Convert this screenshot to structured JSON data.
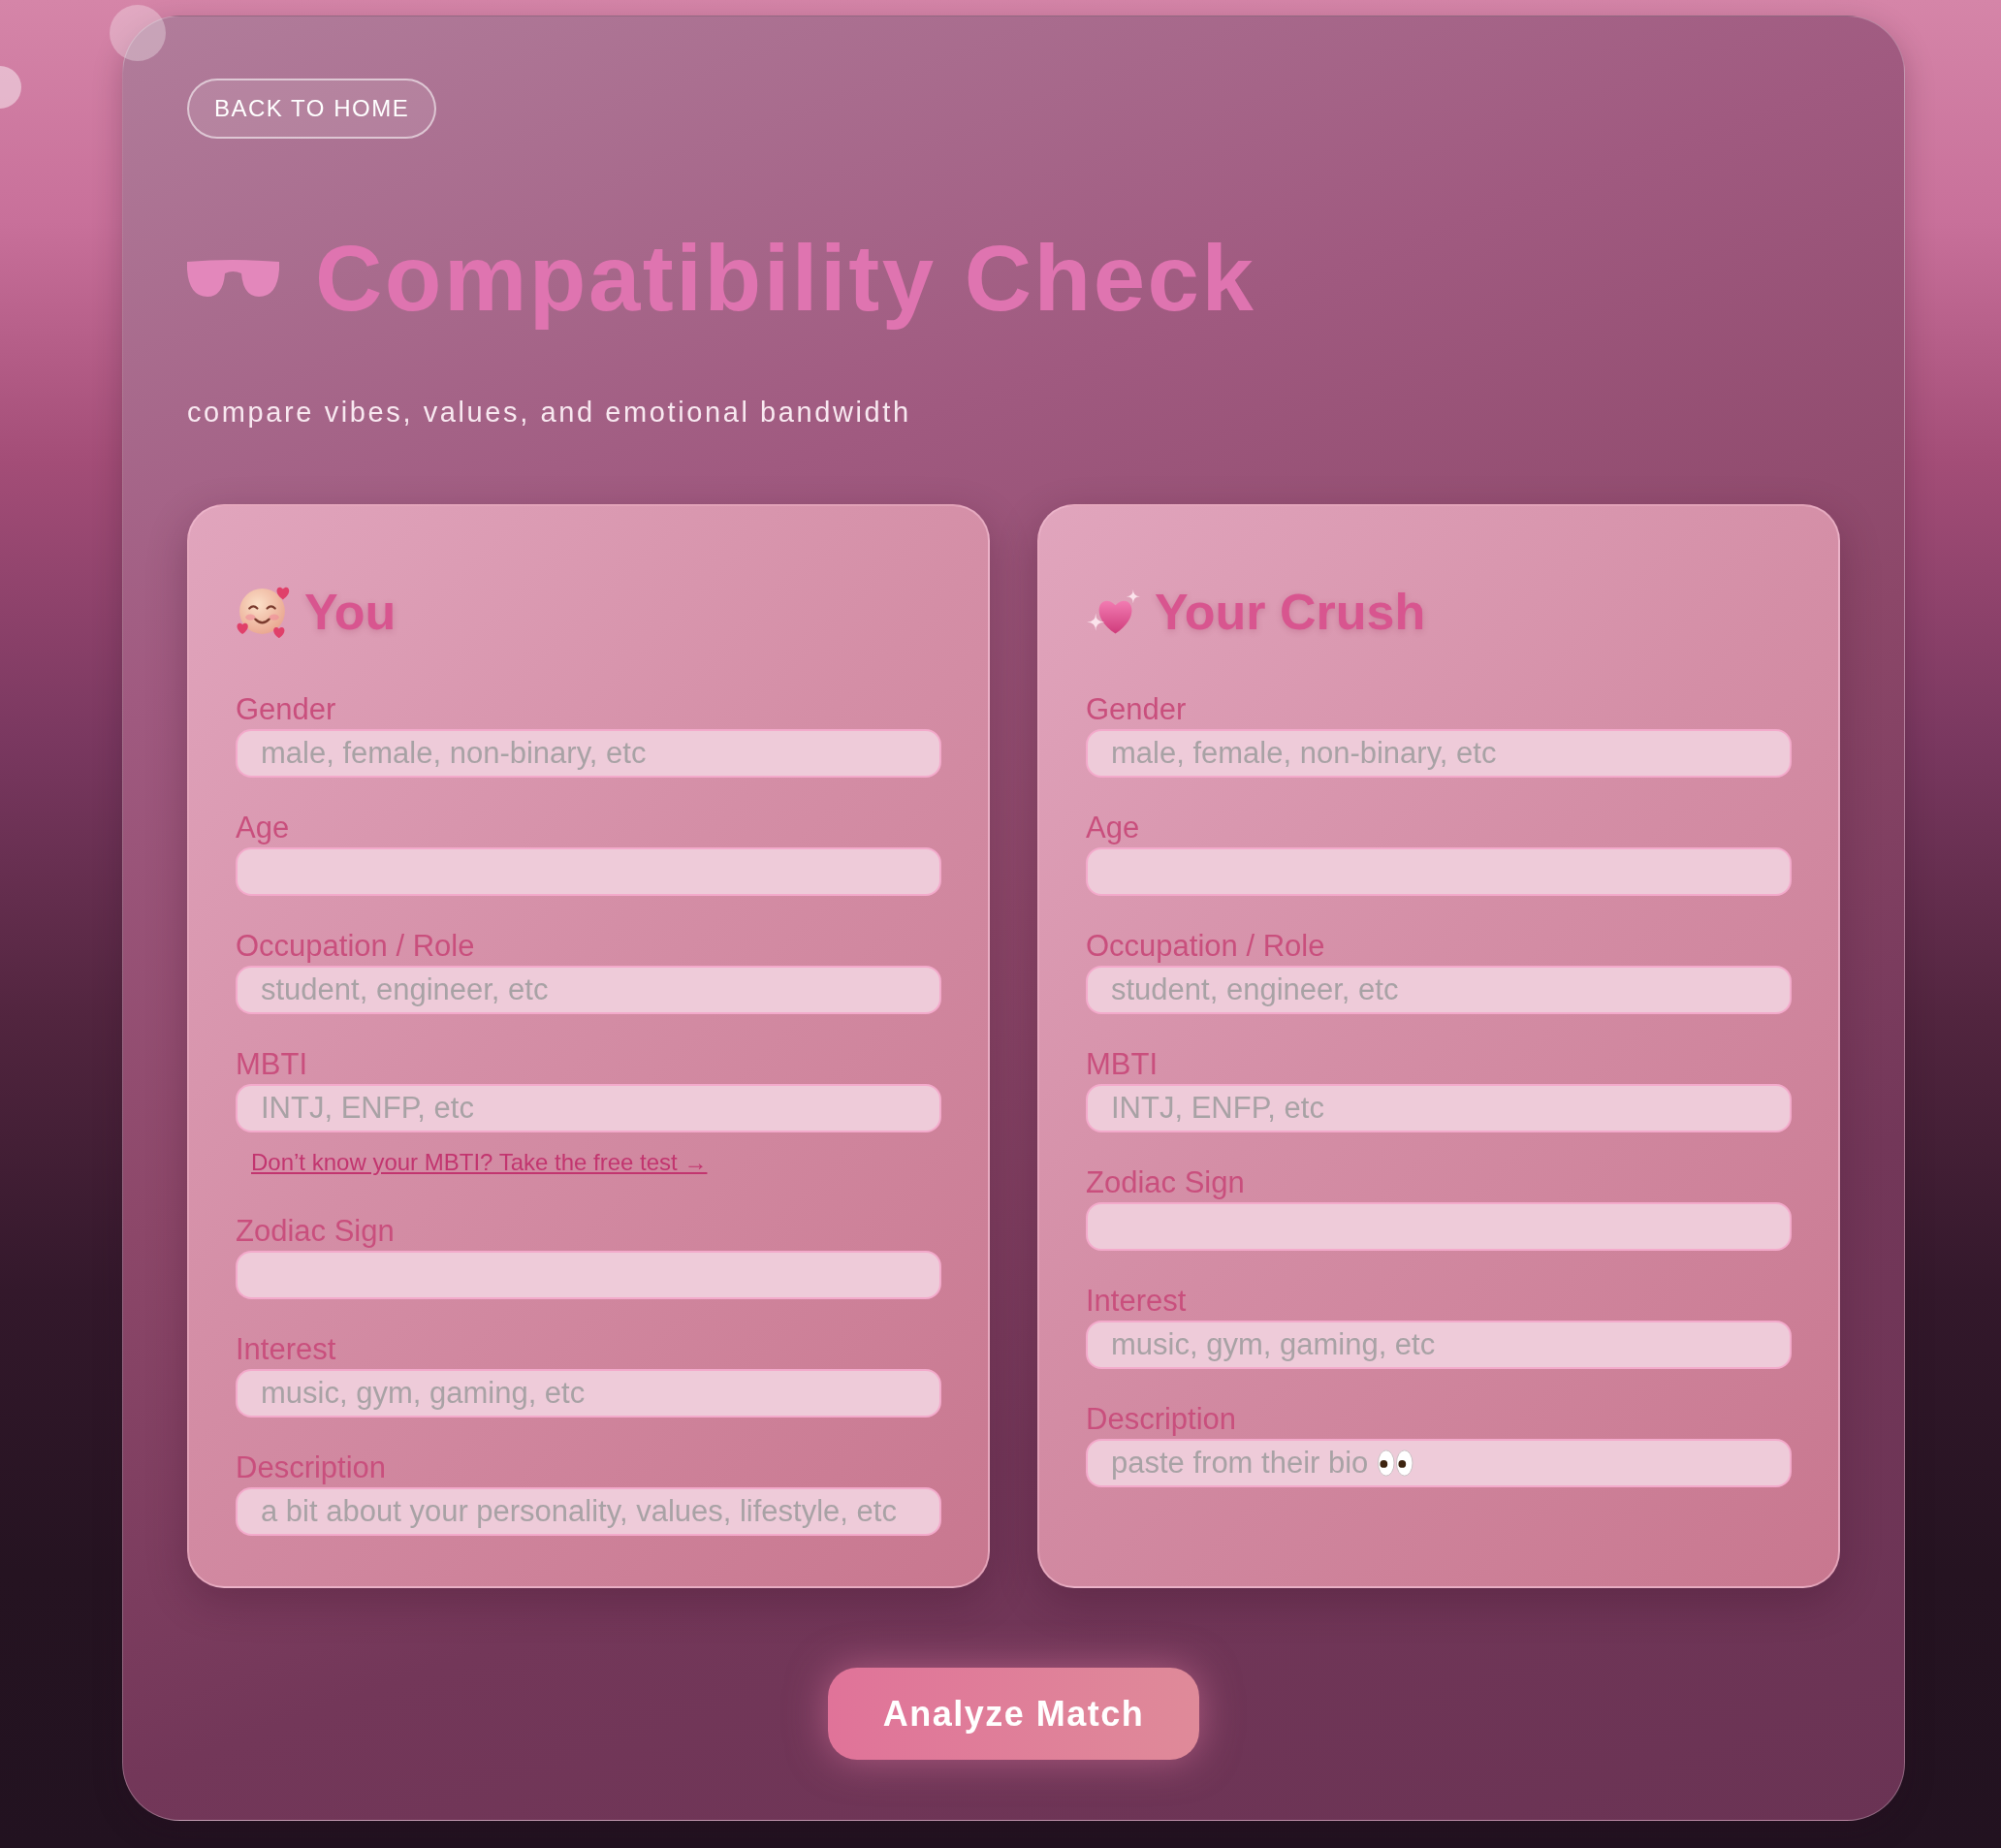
{
  "back_button": {
    "label": "BACK TO HOME"
  },
  "title": "Compatibility Check",
  "subtitle": "compare vibes, values, and emotional bandwidth",
  "cards": [
    {
      "heading": "You",
      "fields": [
        {
          "label": "Gender",
          "placeholder": "male, female, non-binary, etc"
        },
        {
          "label": "Age"
        },
        {
          "label": "Occupation / Role",
          "placeholder": "student, engineer, etc"
        },
        {
          "label": "MBTI",
          "placeholder": "INTJ, ENFP, etc",
          "help_link": "Don’t know your MBTI? Take the free test →"
        },
        {
          "label": "Zodiac Sign"
        },
        {
          "label": "Interest",
          "placeholder": "music, gym, gaming, etc"
        },
        {
          "label": "Description",
          "placeholder": "a bit about your personality, values, lifestyle, etc"
        }
      ]
    },
    {
      "heading": "Your Crush",
      "fields": [
        {
          "label": "Gender",
          "placeholder": "male, female, non-binary, etc"
        },
        {
          "label": "Age"
        },
        {
          "label": "Occupation / Role",
          "placeholder": "student, engineer, etc"
        },
        {
          "label": "MBTI",
          "placeholder": "INTJ, ENFP, etc"
        },
        {
          "label": "Zodiac Sign"
        },
        {
          "label": "Interest",
          "placeholder": "music, gym, gaming, etc"
        },
        {
          "label": "Description",
          "placeholder": "paste from their bio",
          "trailing_icon": true
        }
      ]
    }
  ],
  "analyze_button": {
    "label": "Analyze Match"
  }
}
